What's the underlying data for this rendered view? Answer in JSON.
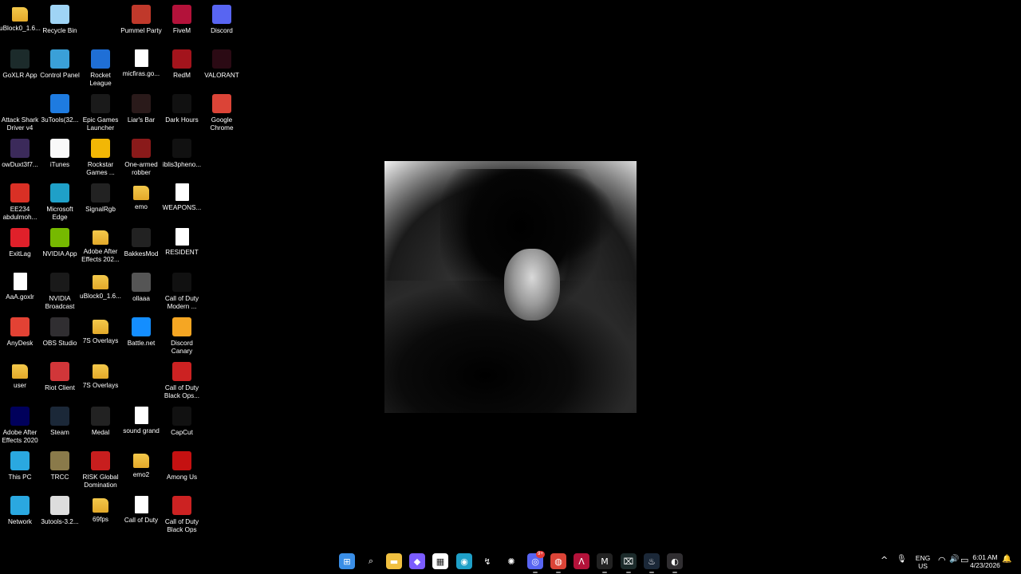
{
  "desktop": {
    "icons": [
      {
        "label": "uBlock0_1.6...",
        "icon": "folder-icon",
        "color": "#f0c040"
      },
      {
        "label": "Recycle Bin",
        "icon": "recycle-bin-icon",
        "color": "#9fd4f5"
      },
      {
        "label": "",
        "icon": "",
        "color": ""
      },
      {
        "label": "Pummel Party",
        "icon": "pummel-party-icon",
        "color": "#c0392b"
      },
      {
        "label": "FiveM",
        "icon": "fivem-icon",
        "color": "#b3123a"
      },
      {
        "label": "Discord",
        "icon": "discord-icon",
        "color": "#5865f2"
      },
      {
        "label": "GoXLR App",
        "icon": "goxlr-icon",
        "color": "#1c2b2b"
      },
      {
        "label": "Control Panel",
        "icon": "control-panel-icon",
        "color": "#3aa0d8"
      },
      {
        "label": "Rocket League",
        "icon": "rocket-league-icon",
        "color": "#1f6fd6"
      },
      {
        "label": "micfiras.go...",
        "icon": "file-icon",
        "color": "#ffffff"
      },
      {
        "label": "RedM",
        "icon": "redm-icon",
        "color": "#a3141c"
      },
      {
        "label": "VALORANT",
        "icon": "valorant-icon",
        "color": "#2b0a14"
      },
      {
        "label": "Attack Shark Driver v4",
        "icon": "attack-shark-icon",
        "color": "#000000"
      },
      {
        "label": "3uTools(32...",
        "icon": "3utools-icon",
        "color": "#1e7be0"
      },
      {
        "label": "Epic Games Launcher",
        "icon": "epic-games-icon",
        "color": "#1a1a1a"
      },
      {
        "label": "Liar's Bar",
        "icon": "liars-bar-icon",
        "color": "#2a1a1a"
      },
      {
        "label": "Dark Hours",
        "icon": "dark-hours-icon",
        "color": "#111111"
      },
      {
        "label": "Google Chrome",
        "icon": "chrome-icon",
        "color": "#db4437"
      },
      {
        "label": "owDuxt3f7...",
        "icon": "image-file-icon",
        "color": "#3b2a5a"
      },
      {
        "label": "iTunes",
        "icon": "itunes-icon",
        "color": "#f9f9f9"
      },
      {
        "label": "Rockstar Games ...",
        "icon": "rockstar-icon",
        "color": "#f2b705"
      },
      {
        "label": "One-armed robber",
        "icon": "one-armed-robber-icon",
        "color": "#8a1a1a"
      },
      {
        "label": "iblis3pheno...",
        "icon": "game-icon",
        "color": "#111111"
      },
      {
        "label": "",
        "icon": "",
        "color": ""
      },
      {
        "label": "EE234 abdulmoh...",
        "icon": "pdf-icon",
        "color": "#d93025"
      },
      {
        "label": "Microsoft Edge",
        "icon": "edge-icon",
        "color": "#1fa0c8"
      },
      {
        "label": "SignalRgb",
        "icon": "signalrgb-icon",
        "color": "#222222"
      },
      {
        "label": "emo",
        "icon": "folder-icon",
        "color": "#f0c040"
      },
      {
        "label": "WEAPONS...",
        "icon": "document-icon",
        "color": "#ffffff"
      },
      {
        "label": "",
        "icon": "",
        "color": ""
      },
      {
        "label": "ExitLag",
        "icon": "exitlag-icon",
        "color": "#e0202a"
      },
      {
        "label": "NVIDIA App",
        "icon": "nvidia-icon",
        "color": "#76b900"
      },
      {
        "label": "Adobe After Effects 202...",
        "icon": "folder-icon",
        "color": "#f0c040"
      },
      {
        "label": "BakkesMod",
        "icon": "bakkesmod-icon",
        "color": "#222222"
      },
      {
        "label": "RESIDENT",
        "icon": "document-icon",
        "color": "#ffffff"
      },
      {
        "label": "",
        "icon": "",
        "color": ""
      },
      {
        "label": "AaA.goxlr",
        "icon": "file-icon",
        "color": "#ffffff"
      },
      {
        "label": "NVIDIA Broadcast",
        "icon": "nvidia-broadcast-icon",
        "color": "#1a1a1a"
      },
      {
        "label": "uBlock0_1.6...",
        "icon": "folder-icon",
        "color": "#f0c040"
      },
      {
        "label": "ollaaa",
        "icon": "image-file-icon",
        "color": "#555555"
      },
      {
        "label": "Call of Duty Modern ...",
        "icon": "cod-modern-icon",
        "color": "#111111"
      },
      {
        "label": "",
        "icon": "",
        "color": ""
      },
      {
        "label": "AnyDesk",
        "icon": "anydesk-icon",
        "color": "#e34234"
      },
      {
        "label": "OBS Studio",
        "icon": "obs-icon",
        "color": "#302e31"
      },
      {
        "label": "7S Overlays",
        "icon": "folder-icon",
        "color": "#f0c040"
      },
      {
        "label": "Battle.net",
        "icon": "battlenet-icon",
        "color": "#148eff"
      },
      {
        "label": "Discord Canary",
        "icon": "discord-canary-icon",
        "color": "#f5a623"
      },
      {
        "label": "",
        "icon": "",
        "color": ""
      },
      {
        "label": "user",
        "icon": "folder-icon",
        "color": "#f0c040"
      },
      {
        "label": "Riot Client",
        "icon": "riot-client-icon",
        "color": "#d13639"
      },
      {
        "label": "7S Overlays",
        "icon": "folder-icon",
        "color": "#f0c040"
      },
      {
        "label": "",
        "icon": "",
        "color": ""
      },
      {
        "label": "Call of Duty Black Ops...",
        "icon": "cod-black-ops-icon",
        "color": "#cc2222"
      },
      {
        "label": "",
        "icon": "",
        "color": ""
      },
      {
        "label": "Adobe After Effects 2020",
        "icon": "after-effects-icon",
        "color": "#00005b"
      },
      {
        "label": "Steam",
        "icon": "steam-icon",
        "color": "#1b2838"
      },
      {
        "label": "Medal",
        "icon": "medal-icon",
        "color": "#222222"
      },
      {
        "label": "sound grand",
        "icon": "document-icon",
        "color": "#ffffff"
      },
      {
        "label": "CapCut",
        "icon": "capcut-icon",
        "color": "#111111"
      },
      {
        "label": "",
        "icon": "",
        "color": ""
      },
      {
        "label": "This PC",
        "icon": "this-pc-icon",
        "color": "#2aa8e0"
      },
      {
        "label": "TRCC",
        "icon": "trcc-icon",
        "color": "#8a7a4a"
      },
      {
        "label": "RISK Global Domination",
        "icon": "risk-icon",
        "color": "#c81e1e"
      },
      {
        "label": "emo2",
        "icon": "folder-icon",
        "color": "#f0c040"
      },
      {
        "label": "Among Us",
        "icon": "among-us-icon",
        "color": "#c51111"
      },
      {
        "label": "",
        "icon": "",
        "color": ""
      },
      {
        "label": "Network",
        "icon": "network-icon",
        "color": "#2aa8e0"
      },
      {
        "label": "3utools-3.2...",
        "icon": "installer-icon",
        "color": "#dddddd"
      },
      {
        "label": "69fps",
        "icon": "folder-icon",
        "color": "#f0c040"
      },
      {
        "label": "Call of Duty",
        "icon": "cod-file-icon",
        "color": "#ffffff"
      },
      {
        "label": "Call of Duty Black Ops",
        "icon": "cod-black-ops-icon",
        "color": "#cc2222"
      },
      {
        "label": "",
        "icon": "",
        "color": ""
      }
    ]
  },
  "taskbar": {
    "apps": [
      {
        "name": "start-button",
        "glyph": "⊞",
        "color": "#3a8ee6"
      },
      {
        "name": "search-icon",
        "glyph": "⌕",
        "color": "#000000"
      },
      {
        "name": "file-explorer-icon",
        "glyph": "▬",
        "color": "#f0c040"
      },
      {
        "name": "copilot-icon",
        "glyph": "◆",
        "color": "#7b5cff"
      },
      {
        "name": "microsoft-store-icon",
        "glyph": "▦",
        "color": "#ffffff"
      },
      {
        "name": "edge-taskbar-icon",
        "glyph": "◉",
        "color": "#1fa0c8"
      },
      {
        "name": "lasso-icon",
        "glyph": "↯",
        "color": "#000000"
      },
      {
        "name": "ai-chat-icon",
        "glyph": "✺",
        "color": "#000000"
      },
      {
        "name": "discord-taskbar-icon",
        "glyph": "◎",
        "color": "#5865f2"
      },
      {
        "name": "chrome-taskbar-icon",
        "glyph": "◍",
        "color": "#db4437"
      },
      {
        "name": "fivem-taskbar-icon",
        "glyph": "Λ",
        "color": "#b3123a"
      },
      {
        "name": "medal-taskbar-icon",
        "glyph": "M",
        "color": "#222222"
      },
      {
        "name": "goxlr-taskbar-icon",
        "glyph": "⌧",
        "color": "#1c2b2b"
      },
      {
        "name": "steam-taskbar-icon",
        "glyph": "♨",
        "color": "#1b2838"
      },
      {
        "name": "obs-taskbar-icon",
        "glyph": "◐",
        "color": "#302e31"
      }
    ],
    "discord_badge": "9+",
    "tray": {
      "chevron": "^",
      "mic": "🎙",
      "lang_top": "ENG",
      "lang_bottom": "US",
      "wifi": "◠",
      "volume": "🔊",
      "battery": "▭",
      "time": "6:01 AM",
      "date": "4/23/2026",
      "notify": "🔔"
    }
  }
}
